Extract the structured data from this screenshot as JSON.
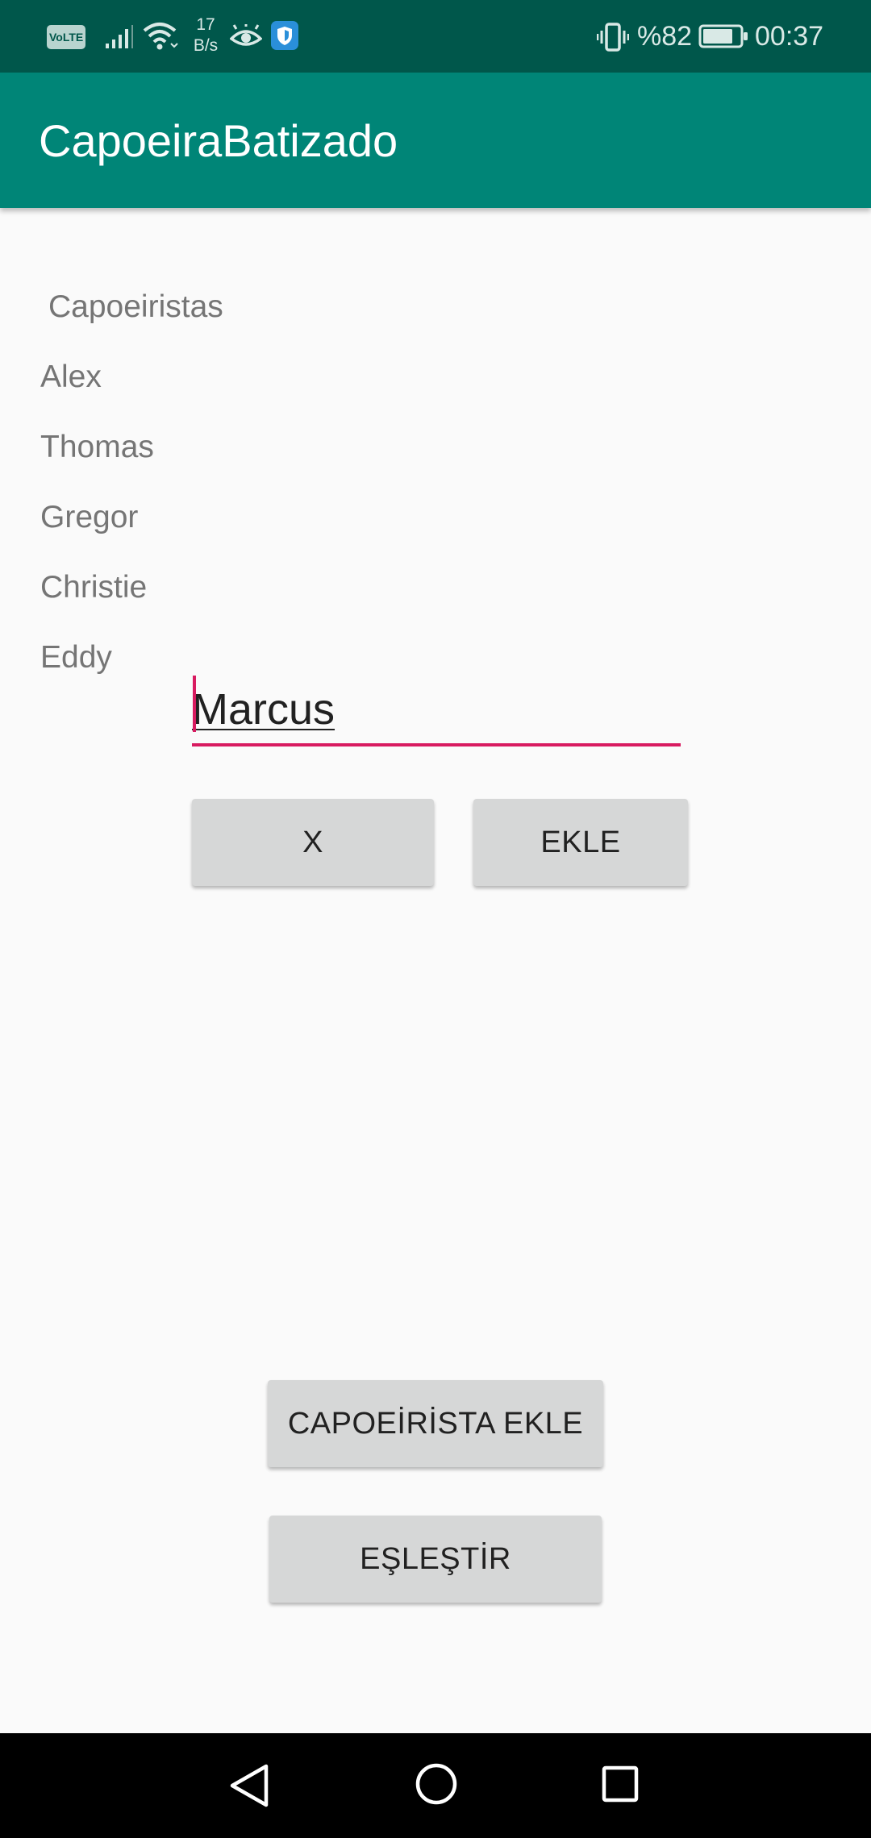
{
  "status_bar": {
    "volte_label": "VoLTE",
    "net_speed_value": "17",
    "net_speed_unit": "B/s",
    "battery_percent": "%82",
    "time": "00:37",
    "icons": [
      "signal-icon",
      "wifi-icon",
      "eye-icon",
      "shield-icon",
      "vibrate-icon",
      "battery-icon"
    ],
    "battery_level": 0.82
  },
  "app_bar": {
    "title": "CapoeiraBatizado",
    "color": "#008577",
    "status_color": "#00574b"
  },
  "list": {
    "header": "Capoeiristas",
    "items": [
      "Alex",
      "Thomas",
      "Gregor",
      "Christie",
      "Eddy"
    ]
  },
  "name_input": {
    "value": "Marcus",
    "accent_color": "#d81b60"
  },
  "buttons": {
    "clear_label": "X",
    "add_label": "EKLE",
    "add_capoeirista_label": "CAPOEİRİSTA EKLE",
    "match_label": "EŞLEŞTİR"
  },
  "nav_bar": {
    "icons": [
      "back-icon",
      "home-icon",
      "recent-apps-icon"
    ]
  }
}
